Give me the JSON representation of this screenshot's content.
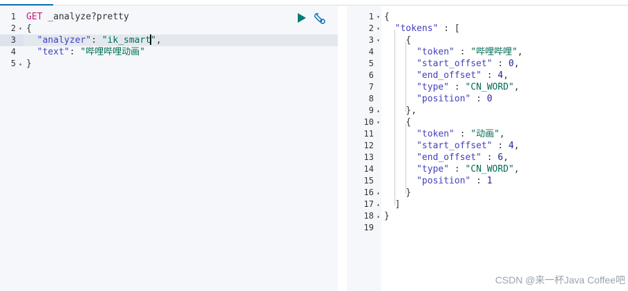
{
  "request_editor": {
    "lines": [
      {
        "num": "1",
        "fold": "",
        "active": false,
        "tokens": [
          {
            "t": "GET",
            "c": "k-method"
          },
          {
            "t": " _analyze?pretty",
            "c": "k-url"
          }
        ]
      },
      {
        "num": "2",
        "fold": "▾",
        "active": false,
        "tokens": [
          {
            "t": "{",
            "c": "k-punc"
          }
        ]
      },
      {
        "num": "3",
        "fold": "",
        "active": true,
        "tokens": [
          {
            "t": "  ",
            "c": "k-punc"
          },
          {
            "t": "\"analyzer\"",
            "c": "k-key"
          },
          {
            "t": ": ",
            "c": "k-punc"
          },
          {
            "t": "\"ik_smart",
            "c": "k-str"
          },
          {
            "t": "|",
            "c": "caret"
          },
          {
            "t": "\"",
            "c": "k-str"
          },
          {
            "t": ",",
            "c": "k-punc"
          }
        ]
      },
      {
        "num": "4",
        "fold": "",
        "active": false,
        "tokens": [
          {
            "t": "  ",
            "c": "k-punc"
          },
          {
            "t": "\"text\"",
            "c": "k-key"
          },
          {
            "t": ": ",
            "c": "k-punc"
          },
          {
            "t": "\"哔哩哔哩动画\"",
            "c": "k-str"
          }
        ]
      },
      {
        "num": "5",
        "fold": "▴",
        "active": false,
        "tokens": [
          {
            "t": "}",
            "c": "k-punc"
          }
        ]
      }
    ],
    "toolbar": {
      "run_icon": "play-icon",
      "settings_icon": "wrench-icon"
    }
  },
  "response_viewer": {
    "lines": [
      {
        "num": "1",
        "fold": "▾",
        "tokens": [
          {
            "t": "{",
            "c": "k-punc"
          }
        ]
      },
      {
        "num": "2",
        "fold": "▾",
        "tokens": [
          {
            "t": "  ",
            "c": "k-punc"
          },
          {
            "t": "\"tokens\"",
            "c": "k-key"
          },
          {
            "t": " : [",
            "c": "k-punc"
          }
        ]
      },
      {
        "num": "3",
        "fold": "▾",
        "tokens": [
          {
            "t": "    {",
            "c": "k-punc"
          }
        ]
      },
      {
        "num": "4",
        "fold": "",
        "tokens": [
          {
            "t": "      ",
            "c": "k-punc"
          },
          {
            "t": "\"token\"",
            "c": "k-key"
          },
          {
            "t": " : ",
            "c": "k-punc"
          },
          {
            "t": "\"哔哩哔哩\"",
            "c": "k-str"
          },
          {
            "t": ",",
            "c": "k-punc"
          }
        ]
      },
      {
        "num": "5",
        "fold": "",
        "tokens": [
          {
            "t": "      ",
            "c": "k-punc"
          },
          {
            "t": "\"start_offset\"",
            "c": "k-key"
          },
          {
            "t": " : ",
            "c": "k-punc"
          },
          {
            "t": "0",
            "c": "k-num"
          },
          {
            "t": ",",
            "c": "k-punc"
          }
        ]
      },
      {
        "num": "6",
        "fold": "",
        "tokens": [
          {
            "t": "      ",
            "c": "k-punc"
          },
          {
            "t": "\"end_offset\"",
            "c": "k-key"
          },
          {
            "t": " : ",
            "c": "k-punc"
          },
          {
            "t": "4",
            "c": "k-num"
          },
          {
            "t": ",",
            "c": "k-punc"
          }
        ]
      },
      {
        "num": "7",
        "fold": "",
        "tokens": [
          {
            "t": "      ",
            "c": "k-punc"
          },
          {
            "t": "\"type\"",
            "c": "k-key"
          },
          {
            "t": " : ",
            "c": "k-punc"
          },
          {
            "t": "\"CN_WORD\"",
            "c": "k-str"
          },
          {
            "t": ",",
            "c": "k-punc"
          }
        ]
      },
      {
        "num": "8",
        "fold": "",
        "tokens": [
          {
            "t": "      ",
            "c": "k-punc"
          },
          {
            "t": "\"position\"",
            "c": "k-key"
          },
          {
            "t": " : ",
            "c": "k-punc"
          },
          {
            "t": "0",
            "c": "k-num"
          }
        ]
      },
      {
        "num": "9",
        "fold": "▴",
        "tokens": [
          {
            "t": "    },",
            "c": "k-punc"
          }
        ]
      },
      {
        "num": "10",
        "fold": "▾",
        "tokens": [
          {
            "t": "    {",
            "c": "k-punc"
          }
        ]
      },
      {
        "num": "11",
        "fold": "",
        "tokens": [
          {
            "t": "      ",
            "c": "k-punc"
          },
          {
            "t": "\"token\"",
            "c": "k-key"
          },
          {
            "t": " : ",
            "c": "k-punc"
          },
          {
            "t": "\"动画\"",
            "c": "k-str"
          },
          {
            "t": ",",
            "c": "k-punc"
          }
        ]
      },
      {
        "num": "12",
        "fold": "",
        "tokens": [
          {
            "t": "      ",
            "c": "k-punc"
          },
          {
            "t": "\"start_offset\"",
            "c": "k-key"
          },
          {
            "t": " : ",
            "c": "k-punc"
          },
          {
            "t": "4",
            "c": "k-num"
          },
          {
            "t": ",",
            "c": "k-punc"
          }
        ]
      },
      {
        "num": "13",
        "fold": "",
        "tokens": [
          {
            "t": "      ",
            "c": "k-punc"
          },
          {
            "t": "\"end_offset\"",
            "c": "k-key"
          },
          {
            "t": " : ",
            "c": "k-punc"
          },
          {
            "t": "6",
            "c": "k-num"
          },
          {
            "t": ",",
            "c": "k-punc"
          }
        ]
      },
      {
        "num": "14",
        "fold": "",
        "tokens": [
          {
            "t": "      ",
            "c": "k-punc"
          },
          {
            "t": "\"type\"",
            "c": "k-key"
          },
          {
            "t": " : ",
            "c": "k-punc"
          },
          {
            "t": "\"CN_WORD\"",
            "c": "k-str"
          },
          {
            "t": ",",
            "c": "k-punc"
          }
        ]
      },
      {
        "num": "15",
        "fold": "",
        "tokens": [
          {
            "t": "      ",
            "c": "k-punc"
          },
          {
            "t": "\"position\"",
            "c": "k-key"
          },
          {
            "t": " : ",
            "c": "k-punc"
          },
          {
            "t": "1",
            "c": "k-num"
          }
        ]
      },
      {
        "num": "16",
        "fold": "▴",
        "tokens": [
          {
            "t": "    }",
            "c": "k-punc"
          }
        ]
      },
      {
        "num": "17",
        "fold": "▴",
        "tokens": [
          {
            "t": "  ]",
            "c": "k-punc"
          }
        ]
      },
      {
        "num": "18",
        "fold": "▴",
        "tokens": [
          {
            "t": "}",
            "c": "k-punc"
          }
        ]
      },
      {
        "num": "19",
        "fold": "",
        "tokens": []
      }
    ]
  },
  "watermark": "CSDN @来一杯Java Coffee吧",
  "colors": {
    "accent": "#006bb4",
    "run_button": "#017d73",
    "method": "#c5197d",
    "key": "#3f3fbf",
    "string": "#006b52"
  }
}
